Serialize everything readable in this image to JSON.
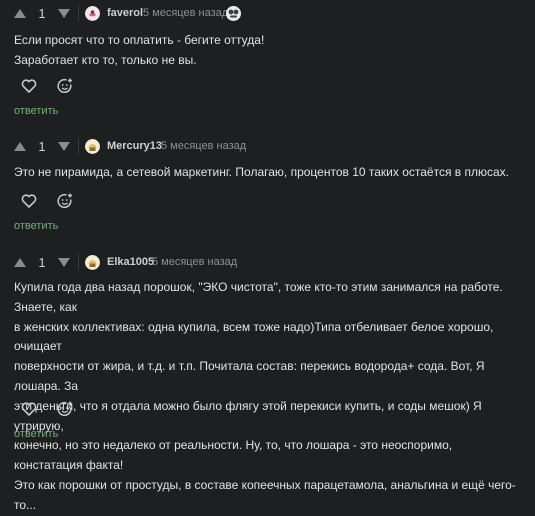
{
  "comments": [
    {
      "score": "1",
      "author": "faverol",
      "date": "5 месяцев назад",
      "lines": [
        "Если просят что то оплатить - бегите оттуда!",
        "Заработает кто то, только не вы."
      ],
      "reply": "ответить"
    },
    {
      "score": "1",
      "author": "Mercury13",
      "date": "5 месяцев назад",
      "lines": [
        "Это не пирамида, а сетевой маркетинг. Полагаю, процентов 10 таких остаётся в плюсах."
      ],
      "reply": "ответить"
    },
    {
      "score": "1",
      "author": "Elka1005",
      "date": "5 месяцев назад",
      "lines": [
        "Купила года два назад порошок, \"ЭКО чистота\", тоже кто-то этим занимался на работе. Знаете, как",
        "в женских коллективах: одна купила, всем тоже надо)Типа отбеливает белое хорошо, очищает",
        "поверхности от жира, и т.д. и т.п. Почитала состав: перекись водорода+ сода. Вот, Я лошара. За",
        "эти деньги, что я отдала можно было флягу этой перекиси купить, и соды мешок) Я утрирую,",
        "конечно, но это недалеко от реальности. Ну, то, что лошара - это неоспоримо, констатация факта!",
        "Это как порошки от простуды, в составе копеечных парацетамола, анальгина и ещё чего-то..."
      ],
      "reply": "ответить"
    }
  ],
  "icons": {
    "upvote": "arrow-up-icon",
    "downvote": "arrow-down-icon",
    "like": "heart-icon",
    "react": "emoji-add-icon"
  },
  "colors": {
    "background": "#1e1f21",
    "reply_link": "#78ad7a",
    "muted": "#8f9092"
  }
}
